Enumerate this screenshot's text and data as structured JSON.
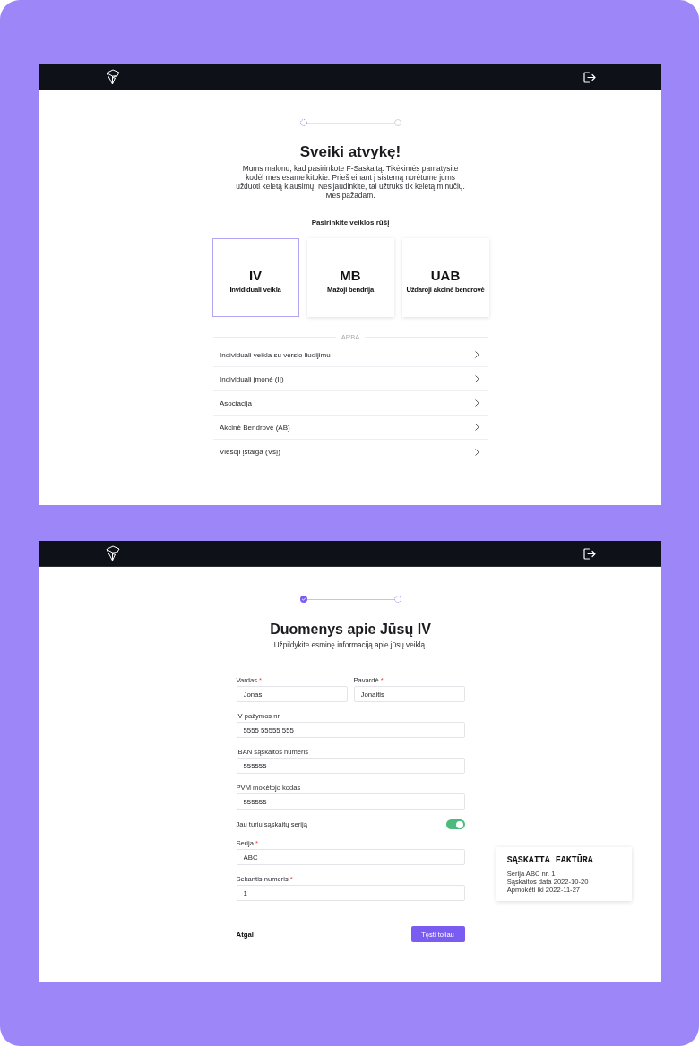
{
  "welcome_screen": {
    "steps": [
      {
        "completed": false,
        "active": true
      },
      {
        "completed": false,
        "active": false
      }
    ],
    "title": "Sveiki atvykę!",
    "intro": "Mums malonu, kad pasirinkote F-Saskaitą. Tikėkimės pamatysite kodėl mes esame kitokie. Prieš einant į sistemą norėtume jums užduoti keletą klausimų. Nesijaudinkite, tai užtruks tik keletą minučių. Mes pažadam.",
    "choice_label": "Pasirinkite veiklos rūšį",
    "cards": [
      {
        "abbr": "IV",
        "name": "Invididuali veikla",
        "selected": true
      },
      {
        "abbr": "MB",
        "name": "Mažoji bendrija",
        "selected": false
      },
      {
        "abbr": "UAB",
        "name": "Uždaroji akcinė bendrovė",
        "selected": false
      }
    ],
    "divider_label": "ARBA",
    "options": [
      "Individuali veikla su verslo liudijimu",
      "Individuali įmonė (IĮ)",
      "Asociacija",
      "Akcinė Bendrovė (AB)",
      "Viešoji įstaiga (VšĮ)"
    ]
  },
  "details_screen": {
    "steps": [
      {
        "completed": true,
        "active": false
      },
      {
        "completed": false,
        "active": true
      }
    ],
    "title": "Duomenys apie Jūsų IV",
    "subtitle": "Užpildykite esminę informaciją apie jūsų veiklą.",
    "form_rows": [
      [
        {
          "kind": "input",
          "label": "Vardas",
          "required_mark": "*",
          "value": "Jonas"
        },
        {
          "kind": "input",
          "label": "Pavardė",
          "required_mark": "*",
          "value": "Jonaitis"
        }
      ],
      [
        {
          "kind": "input",
          "label": "IV pažymos nr.",
          "value": "5555 55555 555"
        }
      ],
      [
        {
          "kind": "input",
          "label": "IBAN sąskaitos numeris",
          "value": "555555"
        }
      ],
      [
        {
          "kind": "input",
          "label": "PVM mokėtojo kodas",
          "value": "555555"
        }
      ],
      [
        {
          "kind": "toggle",
          "label": "Jau turiu sąskaitų seriją",
          "on": true
        }
      ],
      [
        {
          "kind": "input",
          "label": "Serija",
          "required_mark": "*",
          "value": "ABC"
        }
      ],
      [
        {
          "kind": "input",
          "label": "Sekantis numeris",
          "required_mark": "*",
          "value": "1"
        }
      ]
    ],
    "back_button": "Atgal",
    "next_button": "Tęsti toliau",
    "invoice_preview": {
      "title": "SĄSKAITA FAKTŪRA",
      "lines": [
        "Serija ABC nr. 1",
        "Sąskaitos data 2022-10-20",
        "Apmokėti iki 2022-11-27"
      ]
    }
  }
}
